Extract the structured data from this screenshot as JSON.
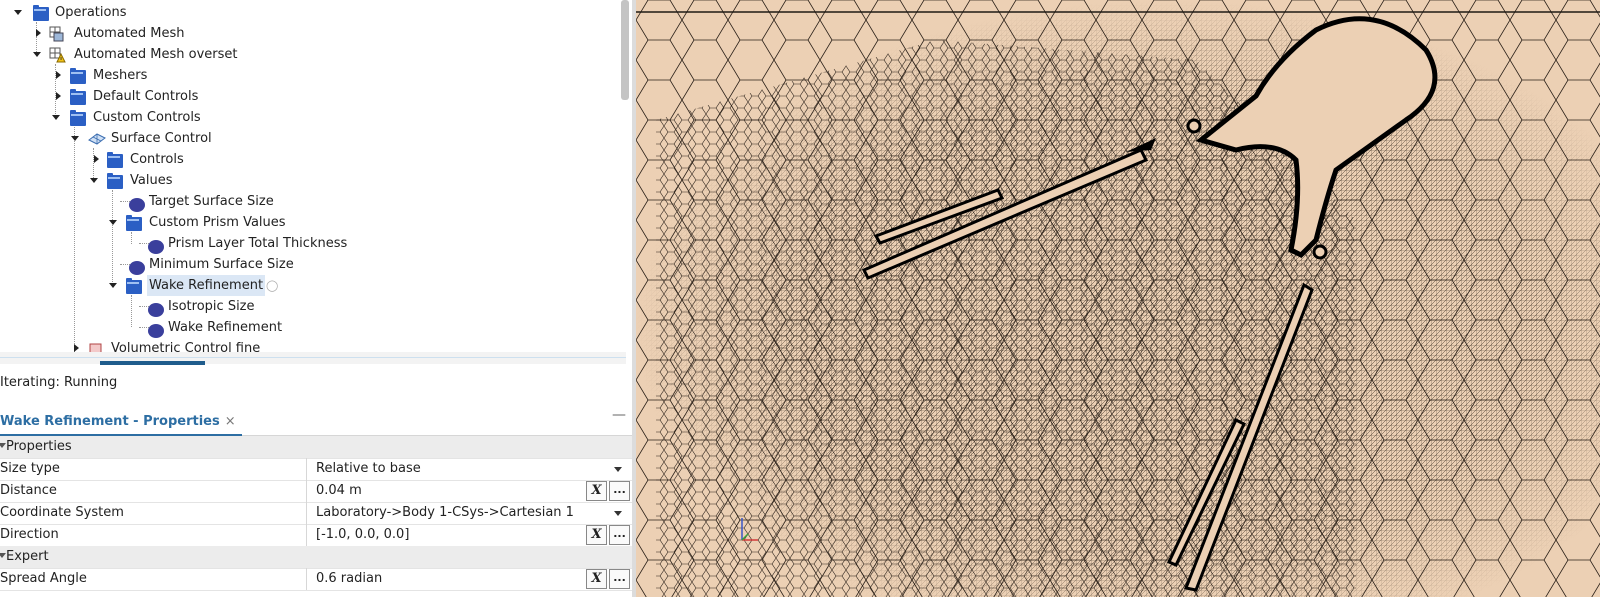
{
  "tree": {
    "nodes": [
      {
        "label": "Operations"
      },
      {
        "label": "Automated Mesh"
      },
      {
        "label": "Automated Mesh overset"
      },
      {
        "label": "Meshers"
      },
      {
        "label": "Default Controls"
      },
      {
        "label": "Custom Controls"
      },
      {
        "label": "Surface Control"
      },
      {
        "label": "Controls"
      },
      {
        "label": "Values"
      },
      {
        "label": "Target Surface Size"
      },
      {
        "label": "Custom Prism Values"
      },
      {
        "label": "Prism Layer Total Thickness"
      },
      {
        "label": "Minimum Surface Size"
      },
      {
        "label": "Wake Refinement"
      },
      {
        "label": "Isotropic Size"
      },
      {
        "label": "Wake Refinement"
      },
      {
        "label": "Volumetric Control fine"
      }
    ]
  },
  "status": {
    "text": "Iterating: Running"
  },
  "properties_panel": {
    "tab_title": "Wake Refinement - Properties",
    "close_glyph": "×",
    "minimize_glyph": "—",
    "rows": [
      {
        "name": "Properties",
        "value": ""
      },
      {
        "name": "Size type",
        "value": "Relative to base"
      },
      {
        "name": "Distance",
        "value": "0.04 m"
      },
      {
        "name": "Coordinate System",
        "value": "Laboratory->Body 1-CSys->Cartesian 1"
      },
      {
        "name": "Direction",
        "value": "[-1.0, 0.0, 0.0]"
      },
      {
        "name": "Expert",
        "value": ""
      },
      {
        "name": "Spread Angle",
        "value": "0.6 radian"
      }
    ],
    "btn_x": "X",
    "btn_dots": "..."
  },
  "viewport": {
    "mesh_fill": "#ecd0b4",
    "mesh_line": "#1f1a14"
  }
}
